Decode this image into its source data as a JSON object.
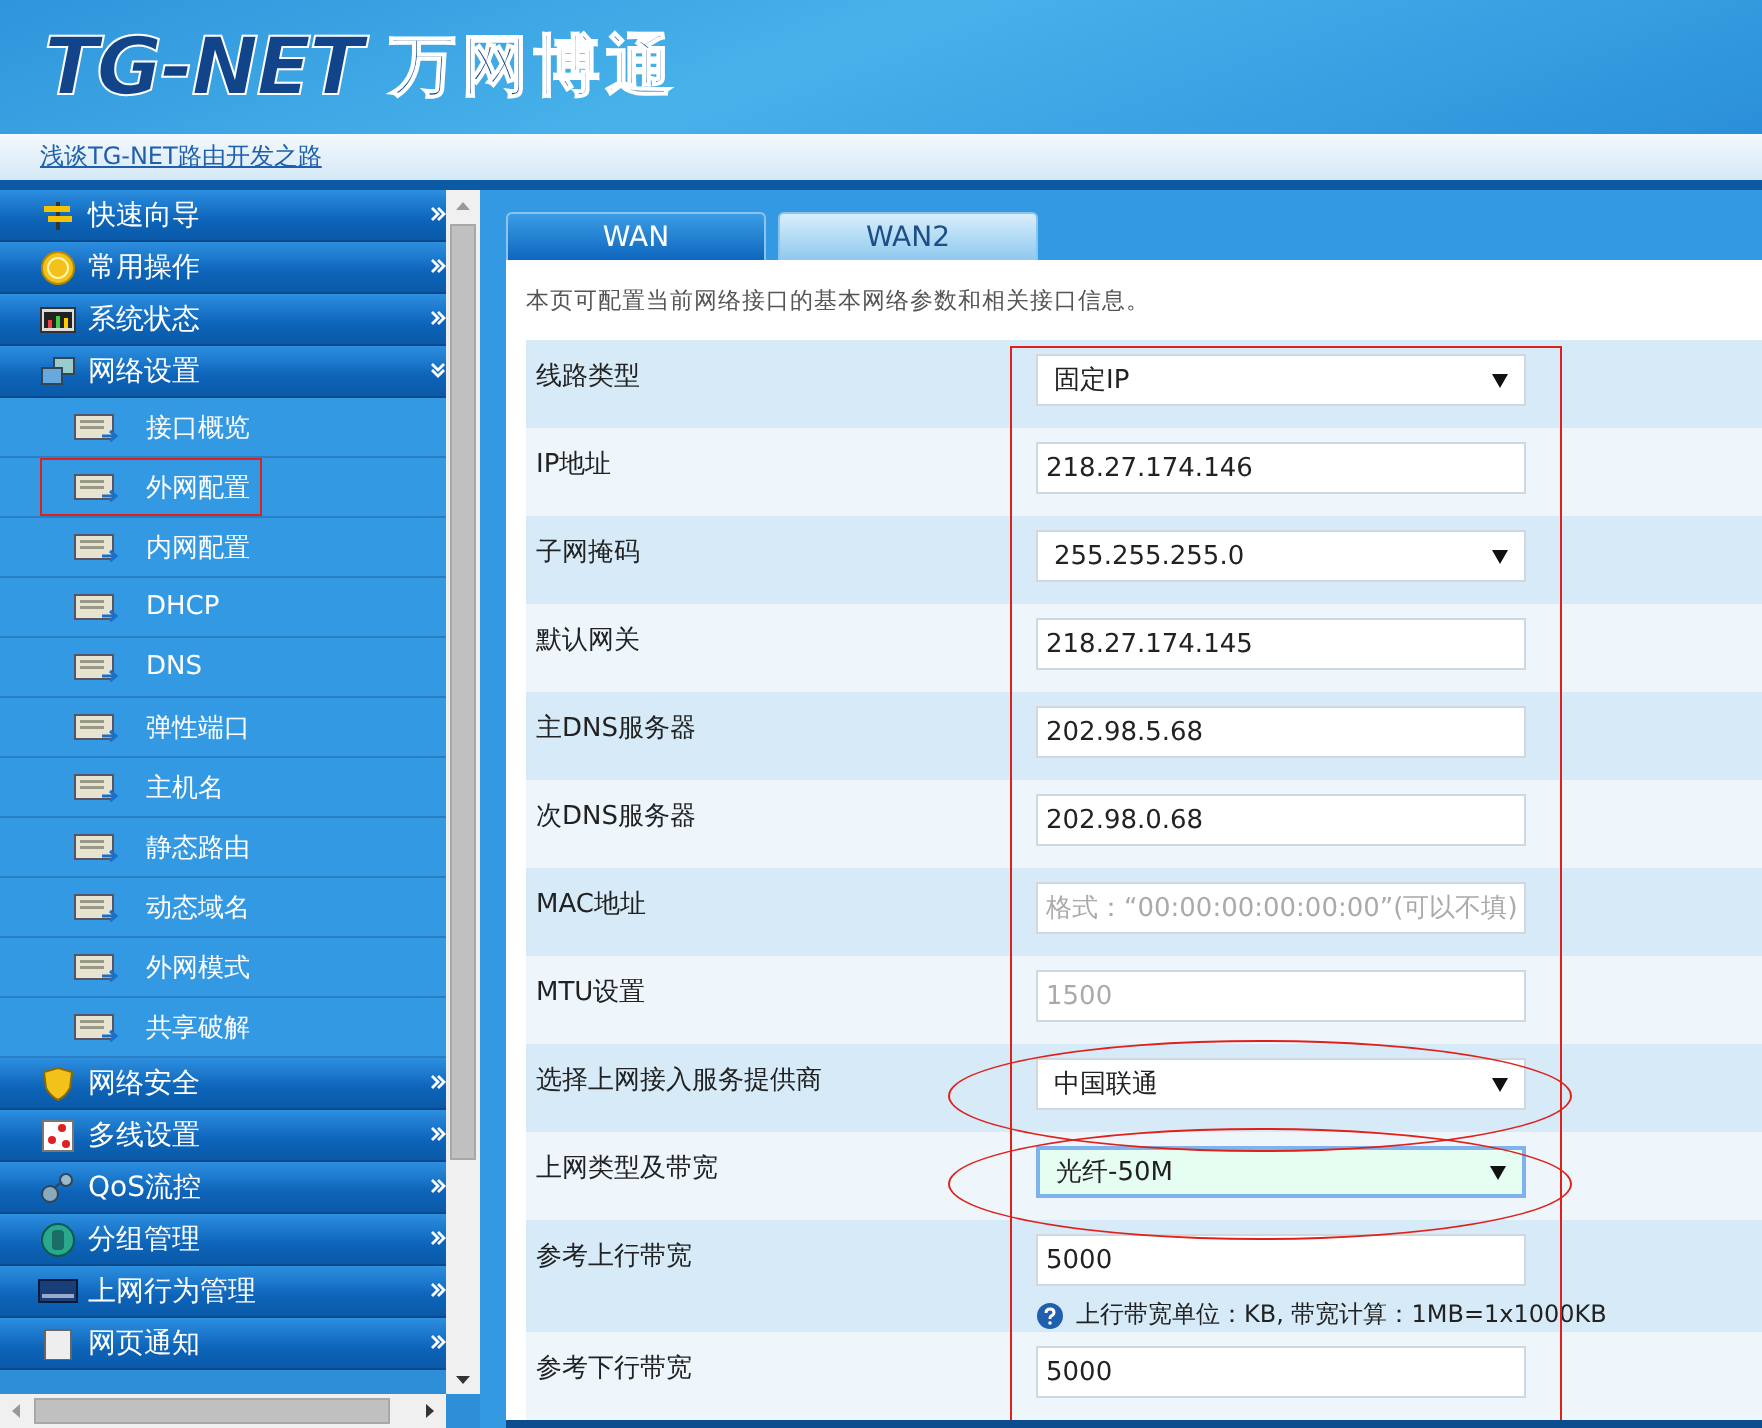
{
  "header": {
    "logo_latin": "TG-NET",
    "logo_chinese": "万网博通"
  },
  "link_bar": {
    "link": "浅谈TG-NET路由开发之路"
  },
  "sidebar": {
    "menu": [
      {
        "label": "快速向导",
        "expanded": false
      },
      {
        "label": "常用操作",
        "expanded": false
      },
      {
        "label": "系统状态",
        "expanded": false
      },
      {
        "label": "网络设置",
        "expanded": true,
        "children": [
          {
            "label": "接口概览",
            "highlighted": false
          },
          {
            "label": "外网配置",
            "highlighted": true
          },
          {
            "label": "内网配置",
            "highlighted": false
          },
          {
            "label": "DHCP",
            "highlighted": false
          },
          {
            "label": "DNS",
            "highlighted": false
          },
          {
            "label": "弹性端口",
            "highlighted": false
          },
          {
            "label": "主机名",
            "highlighted": false
          },
          {
            "label": "静态路由",
            "highlighted": false
          },
          {
            "label": "动态域名",
            "highlighted": false
          },
          {
            "label": "外网模式",
            "highlighted": false
          },
          {
            "label": "共享破解",
            "highlighted": false
          }
        ]
      },
      {
        "label": "网络安全",
        "expanded": false
      },
      {
        "label": "多线设置",
        "expanded": false
      },
      {
        "label": "QoS流控",
        "expanded": false
      },
      {
        "label": "分组管理",
        "expanded": false
      },
      {
        "label": "上网行为管理",
        "expanded": false
      },
      {
        "label": "网页通知",
        "expanded": false
      }
    ]
  },
  "tabs": [
    {
      "label": "WAN",
      "selected": true
    },
    {
      "label": "WAN2",
      "selected": false
    }
  ],
  "form": {
    "description": "本页可配置当前网络接口的基本网络参数和相关接口信息。",
    "column_outlined": true,
    "rows": [
      {
        "label": "线路类型",
        "kind": "select",
        "value": "固定IP",
        "disabled": false,
        "focused": false,
        "circled": false
      },
      {
        "label": "IP地址",
        "kind": "input",
        "value": "218.27.174.146",
        "disabled": false,
        "focused": false,
        "circled": false
      },
      {
        "label": "子网掩码",
        "kind": "select",
        "value": "255.255.255.0",
        "disabled": false,
        "focused": false,
        "circled": false
      },
      {
        "label": "默认网关",
        "kind": "input",
        "value": "218.27.174.145",
        "disabled": false,
        "focused": false,
        "circled": false
      },
      {
        "label": "主DNS服务器",
        "kind": "input",
        "value": "202.98.5.68",
        "disabled": false,
        "focused": false,
        "circled": false
      },
      {
        "label": "次DNS服务器",
        "kind": "input",
        "value": "202.98.0.68",
        "disabled": false,
        "focused": false,
        "circled": false
      },
      {
        "label": "MAC地址",
        "kind": "input",
        "placeholder": "格式：“00:00:00:00:00:00”(可以不填)",
        "disabled": false,
        "focused": false,
        "circled": false
      },
      {
        "label": "MTU设置",
        "kind": "input",
        "placeholder": "1500",
        "disabled": false,
        "focused": false,
        "circled": false
      },
      {
        "label": "选择上网接入服务提供商",
        "kind": "select",
        "value": "中国联通",
        "disabled": false,
        "focused": false,
        "circled": true
      },
      {
        "label": "上网类型及带宽",
        "kind": "select",
        "value": "光纤-50M",
        "disabled": false,
        "focused": true,
        "circled": true
      },
      {
        "label": "参考上行带宽",
        "kind": "input",
        "value": "5000",
        "disabled": false,
        "focused": false,
        "circled": false,
        "hint": "上行带宽单位：KB, 带宽计算：1MB=1x1000KB"
      },
      {
        "label": "参考下行带宽",
        "kind": "input",
        "value": "5000",
        "disabled": false,
        "focused": false,
        "circled": false
      }
    ]
  }
}
